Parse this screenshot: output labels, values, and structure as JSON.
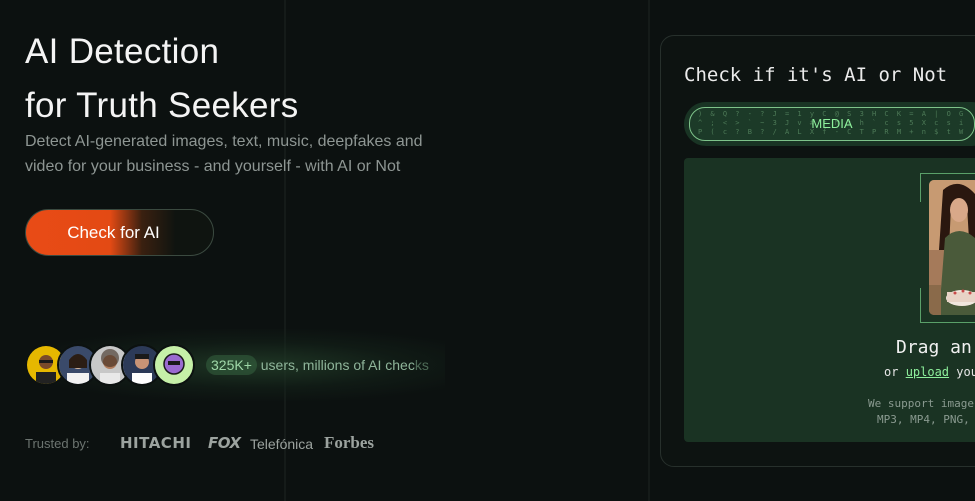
{
  "hero": {
    "title_line1": "AI Detection",
    "title_line2": "for Truth Seekers",
    "subtitle": "Detect AI-generated images, text, music, deepfakes and video for your business - and yourself - with AI or Not",
    "cta_label": "Check for AI"
  },
  "social_proof": {
    "count": "325K+",
    "text_main": " users, millions of AI chec",
    "text_fade": "ks"
  },
  "trusted": {
    "label": "Trusted by:",
    "logos": [
      "HITACHI",
      "FOX",
      "Telefónica",
      "Forbes"
    ]
  },
  "checker": {
    "title": "Check if it's AI or Not",
    "tab_label": "MEDIA",
    "drag_text": "Drag an",
    "upload_prefix": "or ",
    "upload_link": "upload",
    "upload_suffix": " you",
    "support_line1": "We support image",
    "support_line2": "MP3, MP4, PNG,"
  },
  "colors": {
    "background": "#0c1110",
    "accent_green": "#8ef09c",
    "cta_orange": "#e94b16",
    "dropzone": "#1a3323"
  }
}
